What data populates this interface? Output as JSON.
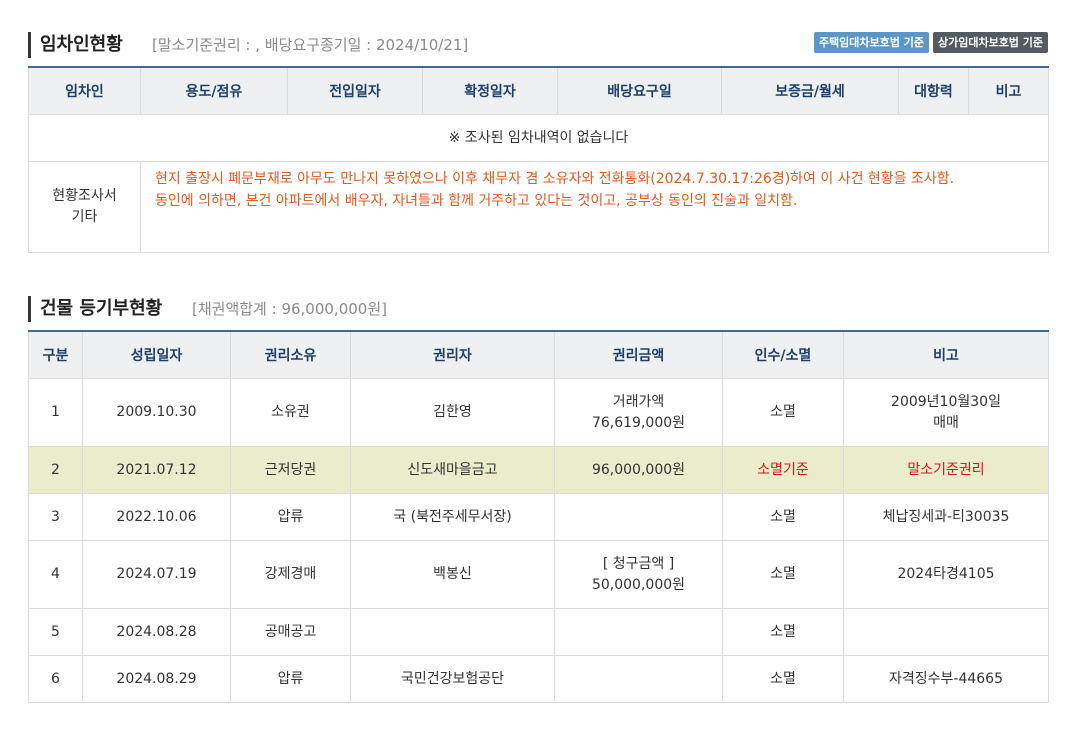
{
  "lease": {
    "title": "임차인현황",
    "subtitle": "[말소기준권리 : , 배당요구종기일 : 2024/10/21]",
    "badges": [
      "주택임대차보호법 기준",
      "상가임대차보호법 기준"
    ],
    "columns": [
      "임차인",
      "용도/점유",
      "전입일자",
      "확정일자",
      "배당요구일",
      "보증금/월세",
      "대항력",
      "비고"
    ],
    "no_data": "※ 조사된 임차내역이 없습니다",
    "survey_label_line1": "현황조사서",
    "survey_label_line2": "기타",
    "survey_line1": "현지 출장시 폐문부재로 아무도 만나지 못하였으나 이후 채무자 겸 소유자와 전화통화(2024.7.30.17:26경)하여 이 사건 현황을 조사함.",
    "survey_line2": "동인에 의하면, 본건 아파트에서 배우자, 자녀들과 함께 거주하고 있다는 것이고, 공부상 동인의 진술과 일치함."
  },
  "building": {
    "title": "건물 등기부현황",
    "subtitle": "[채권액합계 : 96,000,000원]",
    "columns": [
      "구분",
      "성립일자",
      "권리소유",
      "권리자",
      "권리금액",
      "인수/소멸",
      "비고"
    ],
    "rows": [
      {
        "no": "1",
        "date": "2009.10.30",
        "right": "소유권",
        "holder": "김한영",
        "amount1": "거래가액",
        "amount2": "76,619,000원",
        "status": "소멸",
        "note1": "2009년10월30일",
        "note2": "매매"
      },
      {
        "no": "2",
        "date": "2021.07.12",
        "right": "근저당권",
        "holder": "신도새마을금고",
        "amount1": "96,000,000원",
        "amount2": "",
        "status": "소멸기준",
        "note1": "말소기준권리",
        "note2": ""
      },
      {
        "no": "3",
        "date": "2022.10.06",
        "right": "압류",
        "holder": "국 (북전주세무서장)",
        "amount1": "",
        "amount2": "",
        "status": "소멸",
        "note1": "체납징세과-티30035",
        "note2": ""
      },
      {
        "no": "4",
        "date": "2024.07.19",
        "right": "강제경매",
        "holder": "백봉신",
        "amount1": "[ 청구금액 ]",
        "amount2": "50,000,000원",
        "status": "소멸",
        "note1": "2024타경4105",
        "note2": ""
      },
      {
        "no": "5",
        "date": "2024.08.28",
        "right": "공매공고",
        "holder": "",
        "amount1": "",
        "amount2": "",
        "status": "소멸",
        "note1": "",
        "note2": ""
      },
      {
        "no": "6",
        "date": "2024.08.29",
        "right": "압류",
        "holder": "국민건강보험공단",
        "amount1": "",
        "amount2": "",
        "status": "소멸",
        "note1": "자격징수부-44665",
        "note2": ""
      }
    ]
  },
  "colors": {
    "header_text": "#1d3f6a",
    "header_border": "#3c6c93",
    "survey_text": "#e05a1c",
    "highlight_row": "#eaeccc",
    "red_text": "#d9131b",
    "badge_blue": "#5a97c8",
    "badge_dark": "#545a60"
  }
}
